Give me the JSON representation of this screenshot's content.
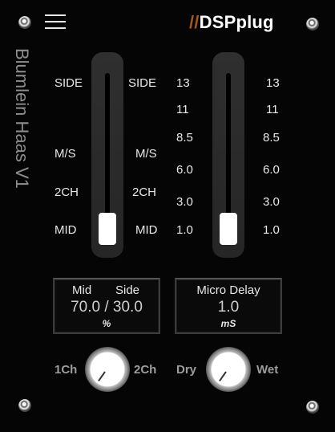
{
  "brand": {
    "slashes": "//",
    "name": "DSPplug"
  },
  "plugin_title": "Blumlein Haas V1",
  "fader_mode": {
    "labels_left": [
      "SIDE",
      "M/S",
      "2CH",
      "MID"
    ],
    "labels_right": [
      "SIDE",
      "M/S",
      "2CH",
      "MID"
    ],
    "position": "MID"
  },
  "fader_delay": {
    "scale_left": [
      "13",
      "11",
      "8.5",
      "6.0",
      "3.0",
      "1.0"
    ],
    "scale_right": [
      "13",
      "11",
      "8.5",
      "6.0",
      "3.0",
      "1.0"
    ],
    "value": 1.0
  },
  "display_balance": {
    "label_left": "Mid",
    "label_right": "Side",
    "value": "70.0 / 30.0",
    "unit": "%"
  },
  "display_delay": {
    "label": "Micro Delay",
    "value": "1.0",
    "unit": "mS"
  },
  "knob_channels": {
    "min_label": "1Ch",
    "max_label": "2Ch"
  },
  "knob_mix": {
    "min_label": "Dry",
    "max_label": "Wet"
  },
  "colors": {
    "accent": "#a25a1c",
    "background": "#050505",
    "text": "#e8e8e8",
    "muted": "#9d9d9d"
  }
}
